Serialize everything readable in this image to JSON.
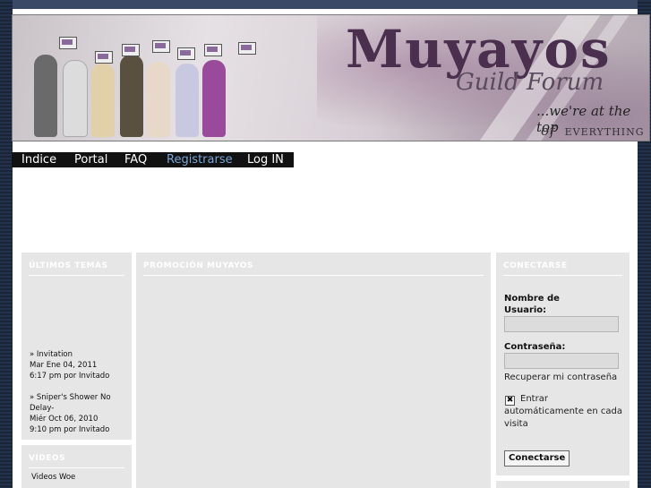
{
  "banner": {
    "title": "Muyayos",
    "subtitle": "Guild Forum",
    "tagline1": "...we're at the top",
    "tagline2_of": "of",
    "tagline2_rest": "EVERYTHING"
  },
  "nav": {
    "items": [
      {
        "label": "Indice"
      },
      {
        "label": "Portal"
      },
      {
        "label": "FAQ"
      },
      {
        "label": "Registrarse"
      },
      {
        "label": "Log IN"
      }
    ],
    "active_color": "#7aa6d6"
  },
  "left": {
    "latest_title": "ÚLTIMOS TEMAS",
    "topics": [
      {
        "title": "» Invitation",
        "date": "Mar Ene 04, 2011",
        "time_by": "6:17 pm por Invitado"
      },
      {
        "title_line1": "» Sniper's Shower No",
        "title_line2": "Delay-",
        "date": "Miér Oct 06, 2010",
        "time_by": "9:10 pm por Invitado"
      }
    ],
    "videos_title": "VIDEOS",
    "videos_item": "Videos Woe"
  },
  "center": {
    "title": "PROMOCIÓN MUYAYOS"
  },
  "right": {
    "title": "CONECTARSE",
    "username_label_1": "Nombre de",
    "username_label_2": "Usuario:",
    "password_label": "Contraseña:",
    "recover_link": "Recuperar mi contraseña",
    "auto_login": "Entrar automáticamente en cada visita",
    "auto_login_checked": "✖",
    "login_button": "Conectarse"
  }
}
